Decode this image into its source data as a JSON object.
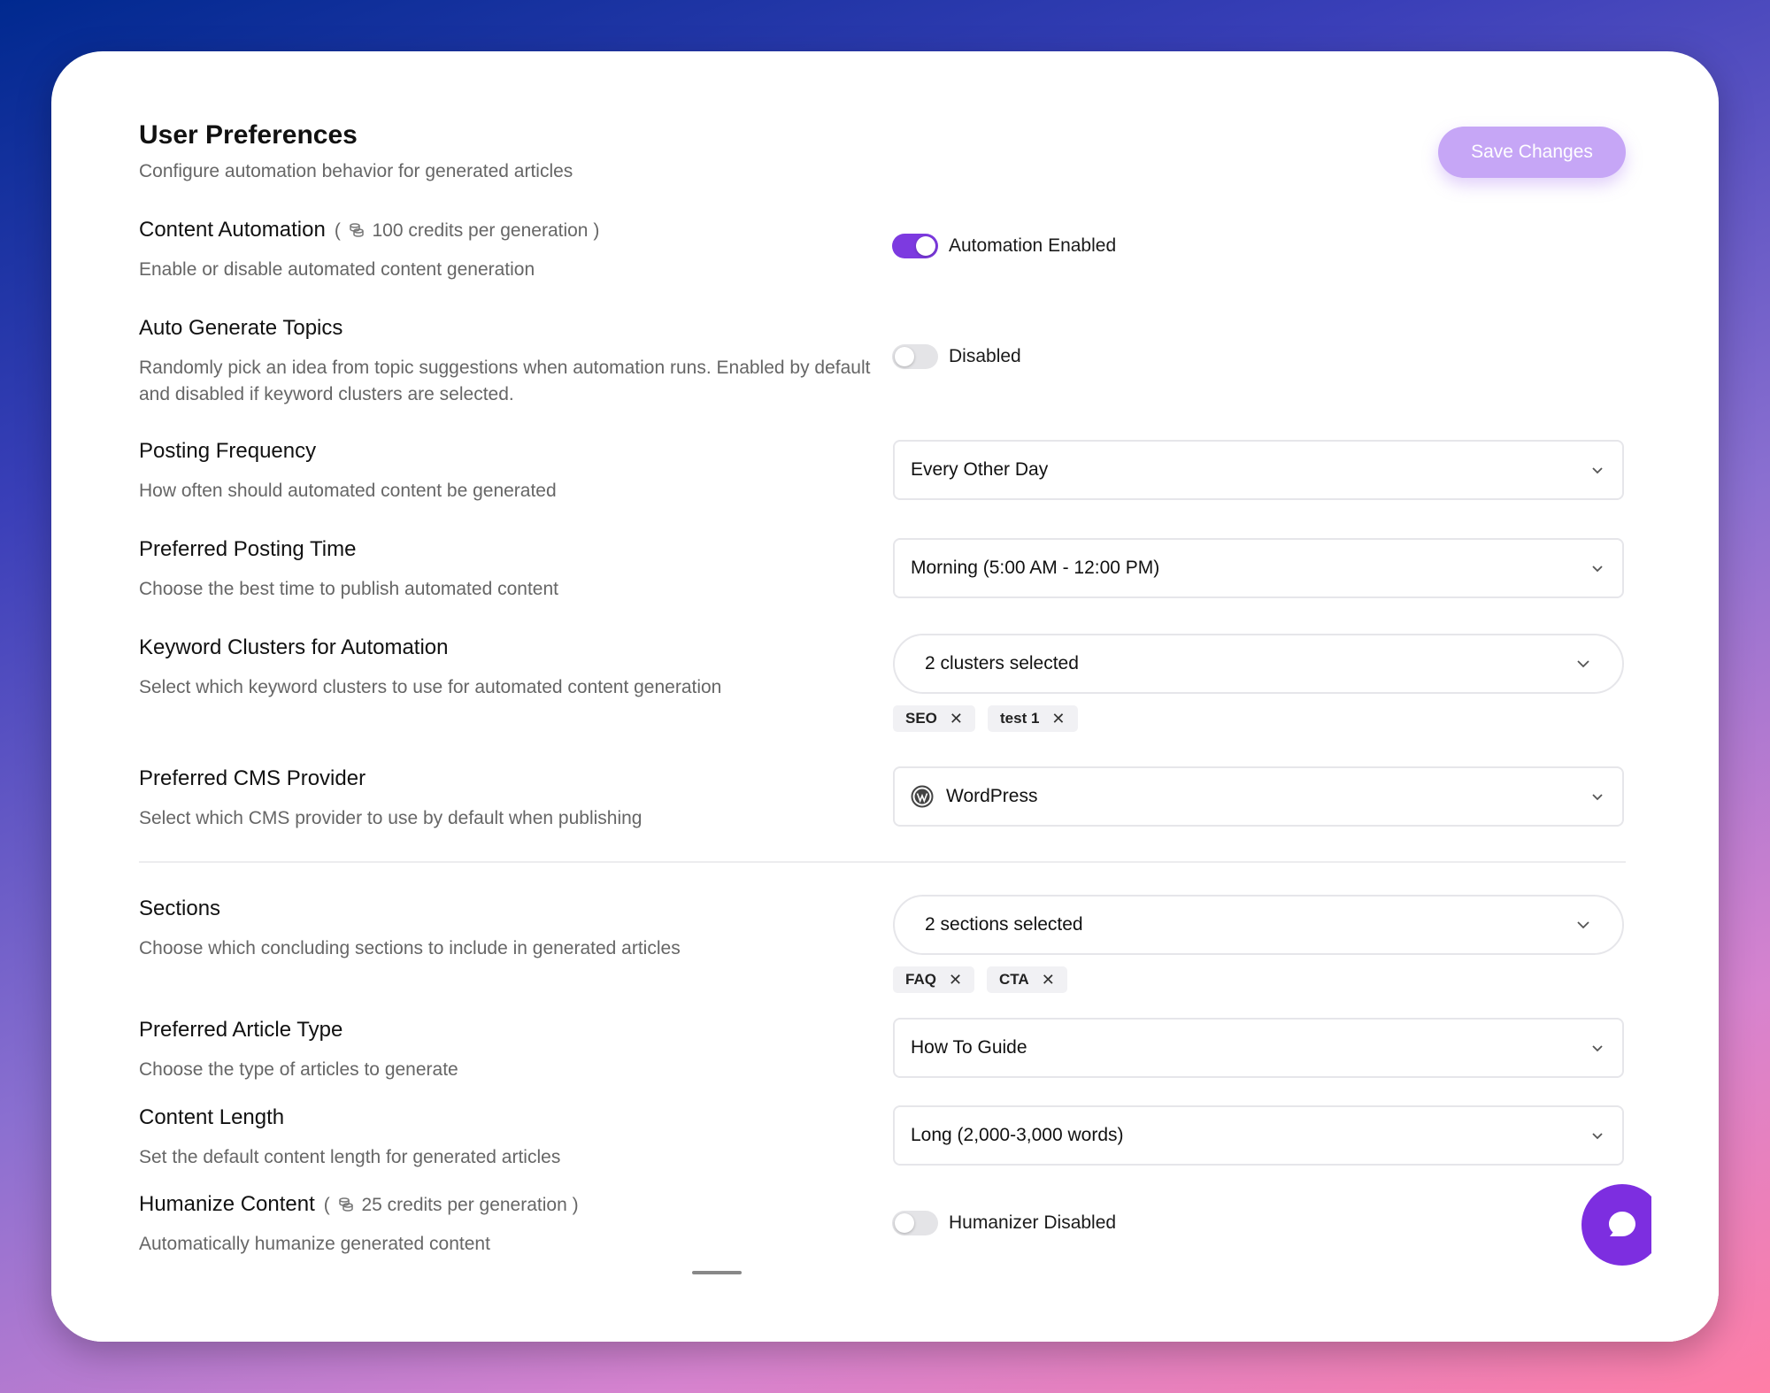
{
  "header": {
    "title": "User Preferences",
    "subtitle": "Configure automation behavior for generated articles",
    "save_label": "Save Changes"
  },
  "content_automation": {
    "label": "Content Automation",
    "credits": "100 credits per generation",
    "description": "Enable or disable automated content generation",
    "enabled": true,
    "status": "Automation Enabled"
  },
  "auto_topics": {
    "label": "Auto Generate Topics",
    "description": "Randomly pick an idea from topic suggestions when automation runs. Enabled by default and disabled if keyword clusters are selected.",
    "enabled": false,
    "status": "Disabled"
  },
  "posting_frequency": {
    "label": "Posting Frequency",
    "description": "How often should automated content be generated",
    "value": "Every Other Day"
  },
  "posting_time": {
    "label": "Preferred Posting Time",
    "description": "Choose the best time to publish automated content",
    "value": "Morning (5:00 AM - 12:00 PM)"
  },
  "keyword_clusters": {
    "label": "Keyword Clusters for Automation",
    "description": "Select which keyword clusters to use for automated content generation",
    "value": "2 clusters selected",
    "chips": [
      "SEO",
      "test 1"
    ]
  },
  "cms_provider": {
    "label": "Preferred CMS Provider",
    "description": "Select which CMS provider to use by default when publishing",
    "value": "WordPress",
    "icon": "wordpress-icon"
  },
  "sections": {
    "label": "Sections",
    "description": "Choose which concluding sections to include in generated articles",
    "value": "2 sections selected",
    "chips": [
      "FAQ",
      "CTA"
    ]
  },
  "article_type": {
    "label": "Preferred Article Type",
    "description": "Choose the type of articles to generate",
    "value": "How To Guide"
  },
  "content_length": {
    "label": "Content Length",
    "description": "Set the default content length for generated articles",
    "value": "Long (2,000-3,000 words)"
  },
  "humanize": {
    "label": "Humanize Content",
    "credits": "25 credits per generation",
    "description": "Automatically humanize generated content",
    "enabled": false,
    "status": "Humanizer Disabled"
  },
  "colors": {
    "accent": "#7d3ae0",
    "save_button": "#c6a6f6",
    "toggle_off": "#e4e4e7"
  },
  "icons": {
    "credits": "coins-icon",
    "chevron": "chevron-down-icon",
    "chat": "chat-bubble-icon",
    "chip_remove": "close-icon"
  }
}
